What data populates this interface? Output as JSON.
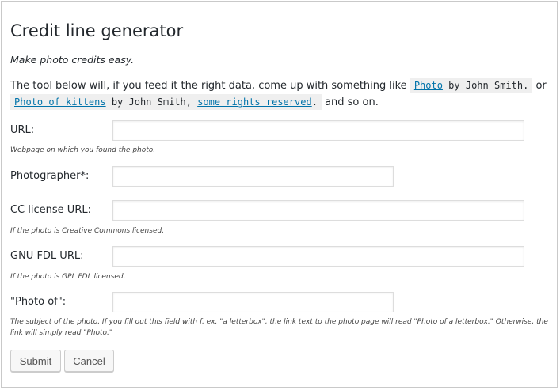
{
  "form": {
    "title": "Credit line generator",
    "tagline": "Make photo credits easy.",
    "intro": {
      "before": "The tool below will, if you feed it the right data, come up with something like",
      "example1": {
        "link": "Photo",
        "rest": " by John Smith."
      },
      "or": "or",
      "example2": {
        "link1": "Photo of kittens",
        "mid": " by John Smith, ",
        "link2": "some rights reserved",
        "end": "."
      },
      "after": "and so on."
    },
    "fields": {
      "url": {
        "label": "URL:",
        "value": "",
        "hint": "Webpage on which you found the photo."
      },
      "photographer": {
        "label": "Photographer*:",
        "value": ""
      },
      "cc_license": {
        "label": "CC license URL:",
        "value": "",
        "hint": "If the photo is Creative Commons licensed."
      },
      "gnu_fdl": {
        "label": "GNU FDL URL:",
        "value": "",
        "hint": "If the photo is GPL FDL licensed."
      },
      "photo_of": {
        "label": "\"Photo of\":",
        "value": "",
        "hint": "The subject of the photo. If you fill out this field with f. ex. \"a letterbox\", the link text to the photo page will read \"Photo of a letterbox.\" Otherwise, the link will simply read \"Photo.\""
      }
    },
    "buttons": {
      "submit": "Submit",
      "cancel": "Cancel"
    }
  }
}
